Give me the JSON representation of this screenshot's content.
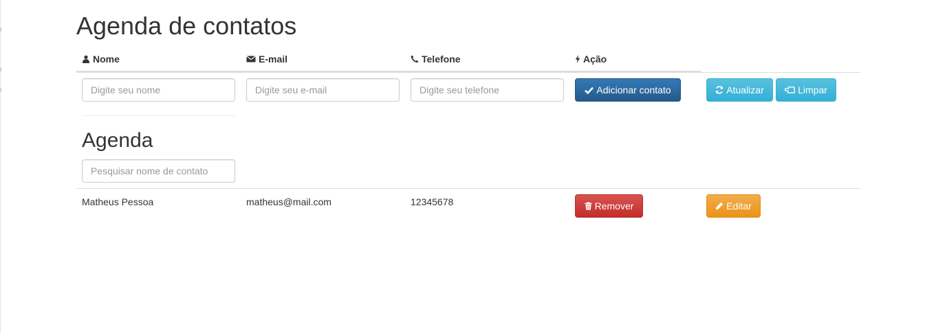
{
  "header": {
    "title": "Agenda de contatos"
  },
  "columns": {
    "name": "Nome",
    "email": "E-mail",
    "phone": "Telefone",
    "action": "Ação"
  },
  "form": {
    "name_placeholder": "Digite seu nome",
    "email_placeholder": "Digite seu e-mail",
    "phone_placeholder": "Digite seu telefone",
    "name_value": "",
    "email_value": "",
    "phone_value": "",
    "add_label": "Adicionar contato",
    "update_label": "Atualizar",
    "clear_label": "Limpar"
  },
  "agenda": {
    "title": "Agenda",
    "search_placeholder": "Pesquisar nome de contato",
    "search_value": ""
  },
  "contacts": [
    {
      "name": "Matheus Pessoa",
      "email": "matheus@mail.com",
      "phone": "12345678",
      "remove_label": "Remover",
      "edit_label": "Editar"
    }
  ],
  "icons": {
    "name": "user-icon",
    "email": "envelope-icon",
    "phone": "phone-icon",
    "action": "bolt-icon",
    "add": "check-icon",
    "update": "refresh-icon",
    "clear": "hand-icon",
    "remove": "trash-icon",
    "edit": "pencil-icon"
  },
  "colors": {
    "primary": "#337ab7",
    "info": "#5bc0de",
    "danger": "#d9534f",
    "warning": "#f0ad4e",
    "text": "#333333"
  }
}
